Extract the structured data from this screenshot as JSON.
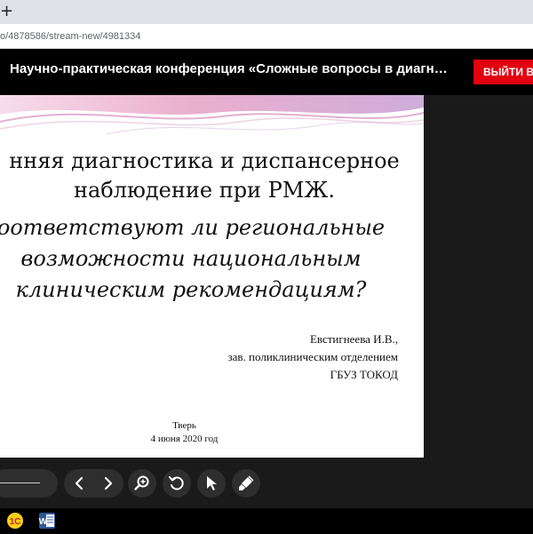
{
  "browser": {
    "new_tab": "+",
    "url": "o/4878586/stream-new/4981334"
  },
  "header": {
    "title": "Научно-практическая конференция «Сложные вопросы в диагн…",
    "exit_label": "ВЫЙТИ В С"
  },
  "slide": {
    "title_line1": "нняя диагностика и диспансерное",
    "title_line2": "наблюдение при РМЖ.",
    "sub_line1": "оответствуют ли региональные",
    "sub_line2": "возможности национальным",
    "sub_line3": "клиническим рекомендациям?",
    "author_name": "Евстигнеева И.В.,",
    "author_role": "зав. поликлиническим отделением",
    "author_org": "ГБУЗ ТОКОД",
    "city": "Тверь",
    "date": "4 июня 2020 год"
  },
  "controls": {
    "icons": [
      "prev-icon",
      "next-icon",
      "zoom-icon",
      "rotate-icon",
      "pointer-icon",
      "brush-icon"
    ]
  },
  "taskbar": {
    "icons": [
      "1c-icon",
      "word-icon"
    ],
    "word_letter": "W"
  },
  "colors": {
    "exit_button": "#e3000f",
    "header_bg": "#000000",
    "stage_bg": "#1a1a1a",
    "wave_pink": "#e8a6c8",
    "wave_purple": "#c9a3d6"
  }
}
